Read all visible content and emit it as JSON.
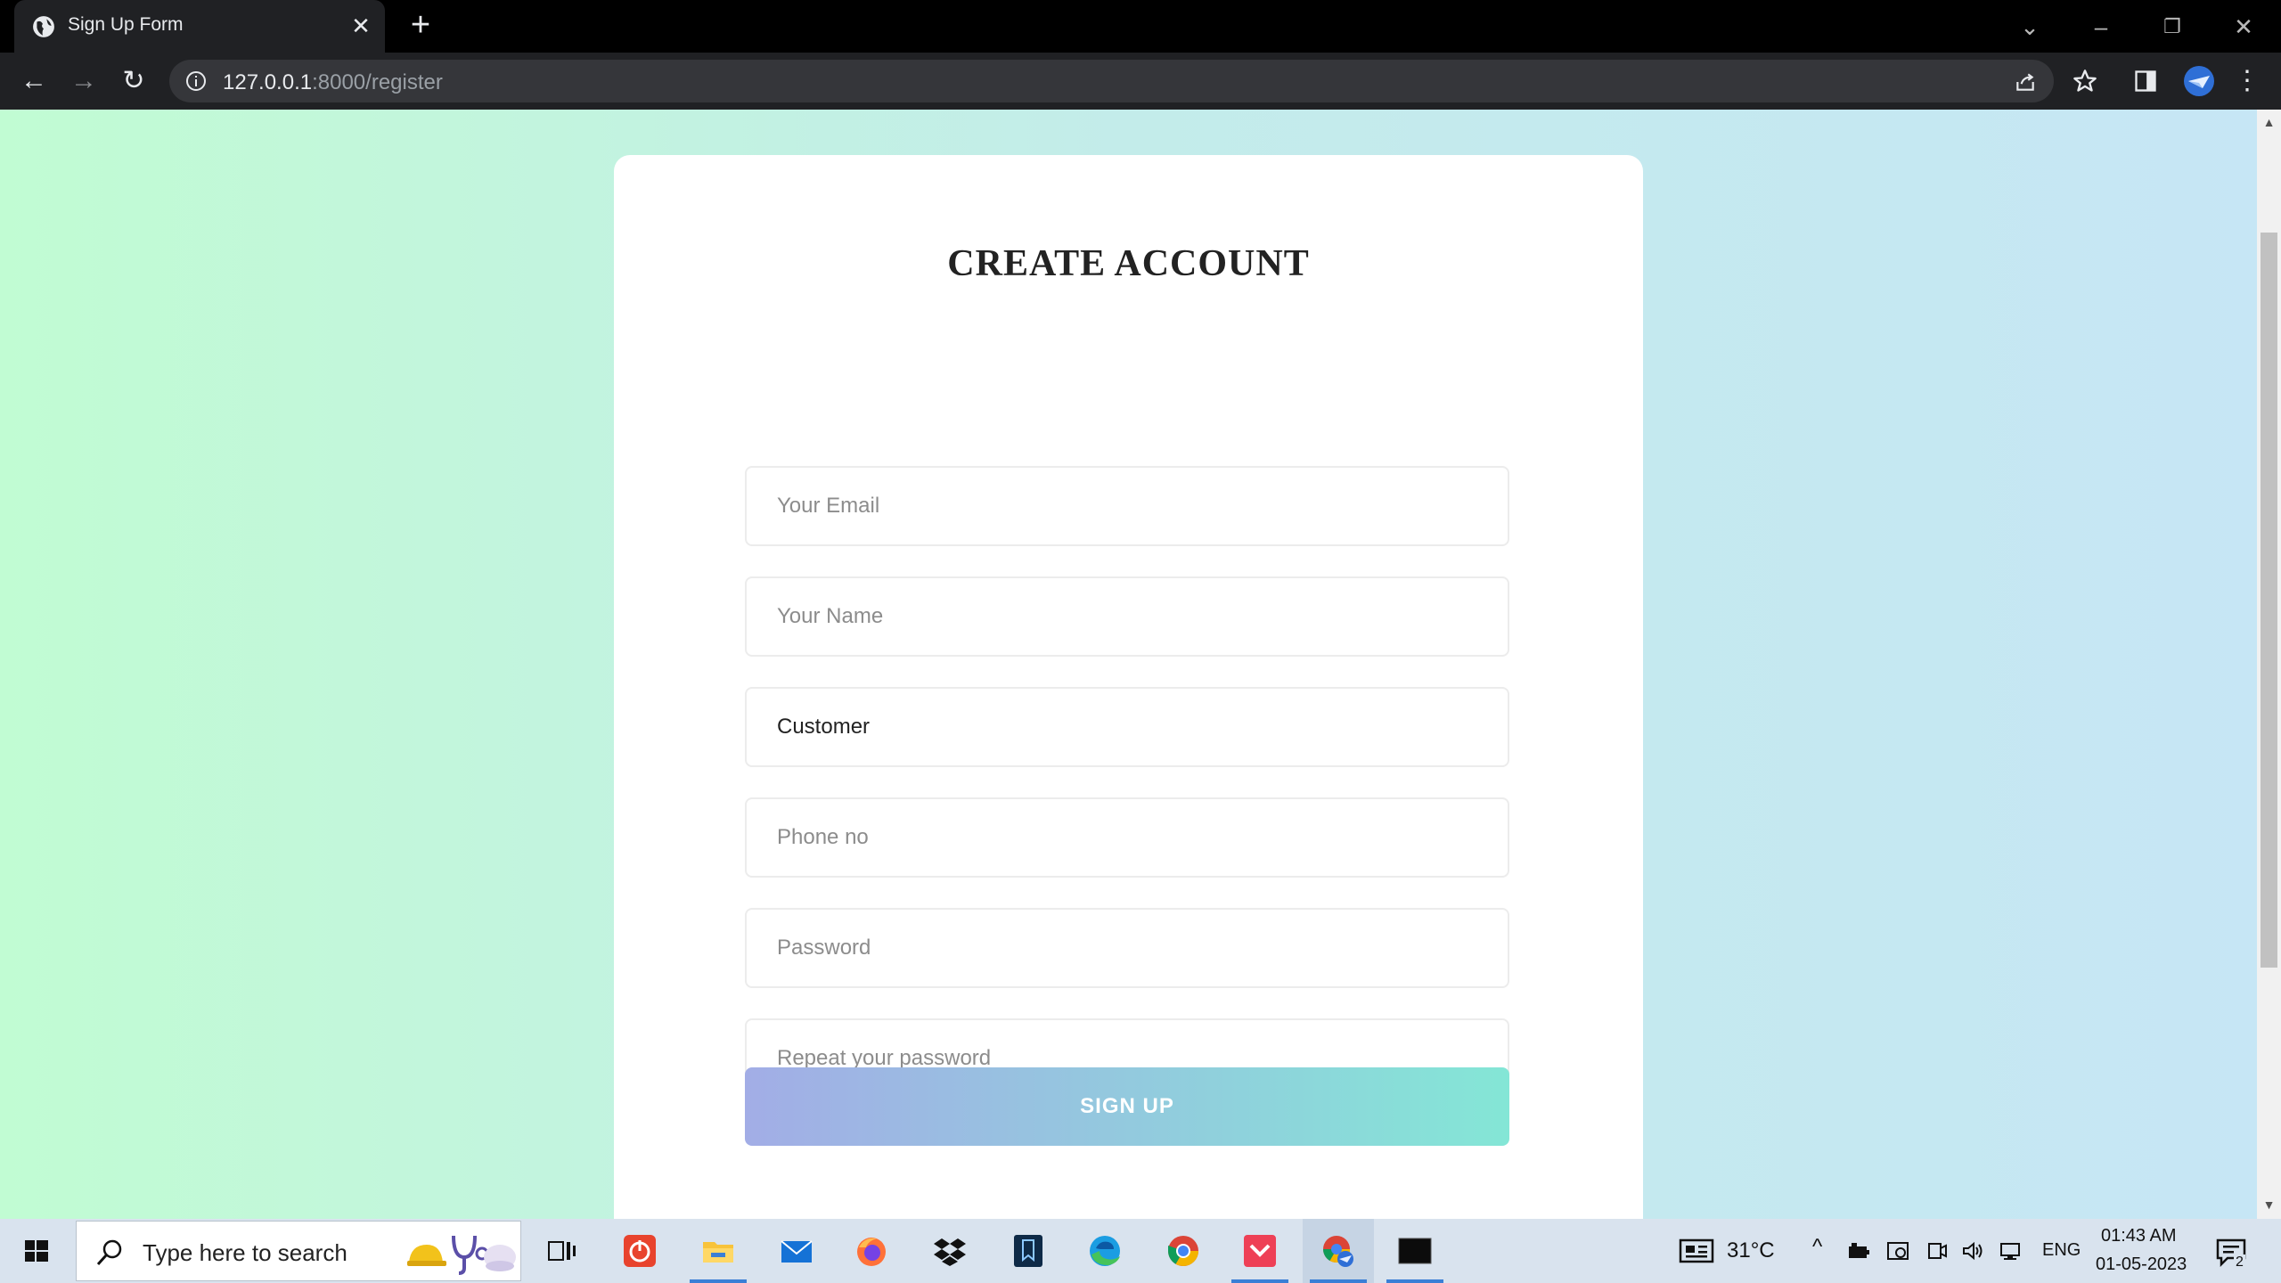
{
  "browser": {
    "tab_title": "Sign Up Form",
    "url_host": "127.0.0.1",
    "url_rest": ":8000/register"
  },
  "page": {
    "heading": "CREATE ACCOUNT",
    "fields": {
      "email_placeholder": "Your Email",
      "name_placeholder": "Your Name",
      "role_value": "Customer",
      "phone_placeholder": "Phone no",
      "password_placeholder": "Password",
      "repeat_password_placeholder": "Repeat your password"
    },
    "submit_label": "SIGN UP",
    "colors": {
      "bg_left": "#c1fcd3",
      "bg_right": "#c6e6f5",
      "button_start": "#a2ade6",
      "button_end": "#84e6d6"
    }
  },
  "taskbar": {
    "search_placeholder": "Type here to search",
    "weather": "31°C",
    "language": "ENG",
    "time": "01:43 AM",
    "date": "01-05-2023",
    "notification_count": "2"
  }
}
